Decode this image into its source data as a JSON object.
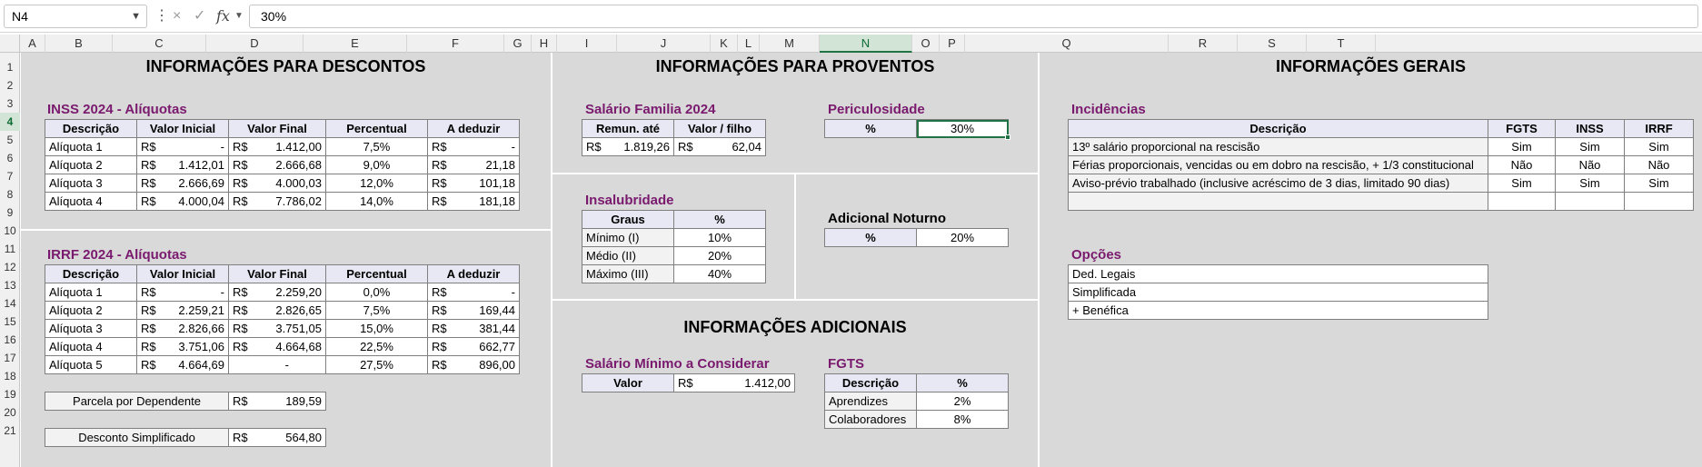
{
  "formula_bar": {
    "name_box": "N4",
    "formula": "30%",
    "cancel_icon": "×",
    "enter_icon": "✓",
    "fx_label": "fx"
  },
  "columns": [
    "A",
    "B",
    "C",
    "D",
    "E",
    "F",
    "G",
    "H",
    "I",
    "J",
    "K",
    "L",
    "M",
    "N",
    "O",
    "P",
    "Q",
    "R",
    "S",
    "T"
  ],
  "rows": [
    "1",
    "2",
    "3",
    "4",
    "5",
    "6",
    "7",
    "8",
    "9",
    "10",
    "11",
    "12",
    "13",
    "14",
    "15",
    "16",
    "17",
    "18",
    "19",
    "20",
    "21"
  ],
  "selected_cell": {
    "column": "N",
    "row": "4"
  },
  "descontos": {
    "title": "INFORMAÇÕES PARA DESCONTOS",
    "inss": {
      "title": "INSS 2024 - Alíquotas",
      "headers": [
        "Descrição",
        "Valor Inicial",
        "Valor Final",
        "Percentual",
        "A deduzir"
      ],
      "rows": [
        [
          "Alíquota 1",
          "R$",
          "-",
          "R$",
          "1.412,00",
          "7,5%",
          "R$",
          "-"
        ],
        [
          "Alíquota 2",
          "R$",
          "1.412,01",
          "R$",
          "2.666,68",
          "9,0%",
          "R$",
          "21,18"
        ],
        [
          "Alíquota 3",
          "R$",
          "2.666,69",
          "R$",
          "4.000,03",
          "12,0%",
          "R$",
          "101,18"
        ],
        [
          "Alíquota 4",
          "R$",
          "4.000,04",
          "R$",
          "7.786,02",
          "14,0%",
          "R$",
          "181,18"
        ]
      ]
    },
    "irrf": {
      "title": "IRRF 2024 - Alíquotas",
      "headers": [
        "Descrição",
        "Valor Inicial",
        "Valor Final",
        "Percentual",
        "A deduzir"
      ],
      "rows": [
        [
          "Alíquota 1",
          "R$",
          "-",
          "R$",
          "2.259,20",
          "0,0%",
          "R$",
          "-"
        ],
        [
          "Alíquota 2",
          "R$",
          "2.259,21",
          "R$",
          "2.826,65",
          "7,5%",
          "R$",
          "169,44"
        ],
        [
          "Alíquota 3",
          "R$",
          "2.826,66",
          "R$",
          "3.751,05",
          "15,0%",
          "R$",
          "381,44"
        ],
        [
          "Alíquota 4",
          "R$",
          "3.751,06",
          "R$",
          "4.664,68",
          "22,5%",
          "R$",
          "662,77"
        ],
        [
          "Alíquota 5",
          "R$",
          "4.664,69",
          "",
          "-",
          "27,5%",
          "R$",
          "896,00"
        ]
      ]
    },
    "dependente": {
      "label": "Parcela por Dependente",
      "currency": "R$",
      "value": "189,59"
    },
    "simplificado": {
      "label": "Desconto Simplificado",
      "currency": "R$",
      "value": "564,80"
    }
  },
  "proventos": {
    "title": "INFORMAÇÕES PARA PROVENTOS",
    "salario_familia": {
      "title": "Salário Familia 2024",
      "headers": [
        "Remun. até",
        "Valor / filho"
      ],
      "currency1": "R$",
      "remun": "1.819,26",
      "currency2": "R$",
      "valor": "62,04"
    },
    "periculosidade": {
      "title": "Periculosidade",
      "label": "%",
      "value": "30%"
    },
    "insalubridade": {
      "title": "Insalubridade",
      "headers": [
        "Graus",
        "%"
      ],
      "rows": [
        [
          "Mínimo (I)",
          "10%"
        ],
        [
          "Médio (II)",
          "20%"
        ],
        [
          "Máximo (III)",
          "40%"
        ]
      ]
    },
    "noturno": {
      "title": "Adicional Noturno",
      "label": "%",
      "value": "20%"
    }
  },
  "adicionais": {
    "title": "INFORMAÇÕES ADICIONAIS",
    "salario_minimo": {
      "title": "Salário Mínimo a Considerar",
      "label": "Valor",
      "currency": "R$",
      "value": "1.412,00"
    },
    "fgts": {
      "title": "FGTS",
      "headers": [
        "Descrição",
        "%"
      ],
      "rows": [
        [
          "Aprendizes",
          "2%"
        ],
        [
          "Colaboradores",
          "8%"
        ]
      ]
    }
  },
  "gerais": {
    "title": "INFORMAÇÕES GERAIS",
    "incidencias": {
      "title": "Incidências",
      "headers": [
        "Descrição",
        "FGTS",
        "INSS",
        "IRRF"
      ],
      "rows": [
        [
          "13º salário proporcional na rescisão",
          "Sim",
          "Sim",
          "Sim"
        ],
        [
          "Férias proporcionais, vencidas ou em dobro na rescisão, + 1/3 constitucional",
          "Não",
          "Não",
          "Não"
        ],
        [
          "Aviso-prévio trabalhado (inclusive acréscimo de 3 dias, limitado 90 dias)",
          "Sim",
          "Sim",
          "Sim"
        ],
        [
          "",
          "",
          "",
          ""
        ]
      ]
    },
    "opcoes": {
      "title": "Opções",
      "items": [
        "Ded. Legais",
        "Simplificada",
        "+ Benéfica"
      ]
    }
  },
  "colors": {
    "accent": "#217346",
    "subtitle": "#7a1a6e",
    "panel": "#d9d9d9",
    "header_fill": "#e8e8f4"
  }
}
